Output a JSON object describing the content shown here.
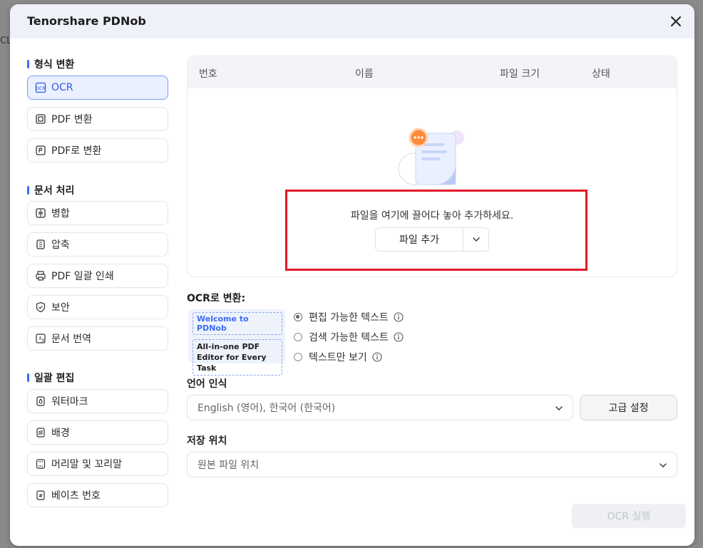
{
  "background_fragment": "CL",
  "dialog": {
    "title": "Tenorshare PDNob"
  },
  "sidebar": {
    "sections": [
      {
        "heading": "형식 변환",
        "items": [
          {
            "label": "OCR",
            "icon": "ocr-icon",
            "active": true
          },
          {
            "label": "PDF 변환",
            "icon": "pdf-convert-icon"
          },
          {
            "label": "PDF로 변환",
            "icon": "convert-to-pdf-icon"
          }
        ]
      },
      {
        "heading": "문서 처리",
        "items": [
          {
            "label": "병합",
            "icon": "merge-icon"
          },
          {
            "label": "압축",
            "icon": "compress-icon"
          },
          {
            "label": "PDF 일괄 인쇄",
            "icon": "printer-icon"
          },
          {
            "label": "보안",
            "icon": "shield-icon"
          },
          {
            "label": "문서 번역",
            "icon": "translate-icon"
          }
        ]
      },
      {
        "heading": "일괄 편집",
        "items": [
          {
            "label": "워터마크",
            "icon": "watermark-icon"
          },
          {
            "label": "배경",
            "icon": "background-icon"
          },
          {
            "label": "머리말 및 꼬리말",
            "icon": "header-footer-icon"
          },
          {
            "label": "베이츠 번호",
            "icon": "bates-number-icon"
          }
        ]
      }
    ]
  },
  "file_table": {
    "columns": [
      "번호",
      "이름",
      "파일 크기",
      "상태"
    ],
    "drop_text": "파일을 여기에 끌어다 놓아 추가하세요.",
    "add_button": "파일 추가"
  },
  "ocr": {
    "heading": "OCR로 변환:",
    "preview_line1": "Welcome to PDNob",
    "preview_line2": "All-in-one PDF Editor for Every Task",
    "options": [
      {
        "label": "편집 가능한 텍스트",
        "selected": true
      },
      {
        "label": "검색 가능한 텍스트",
        "selected": false
      },
      {
        "label": "텍스트만 보기",
        "selected": false
      }
    ]
  },
  "language": {
    "heading": "언어 인식",
    "value": "English (영어), 한국어 (한국어)",
    "advanced_button": "고급 설정"
  },
  "save": {
    "heading": "저장 위치",
    "value": "원본 파일 위치"
  },
  "run_button": "OCR 실행",
  "colors": {
    "accent": "#3b6cf6",
    "highlight": "#e21b2a"
  }
}
